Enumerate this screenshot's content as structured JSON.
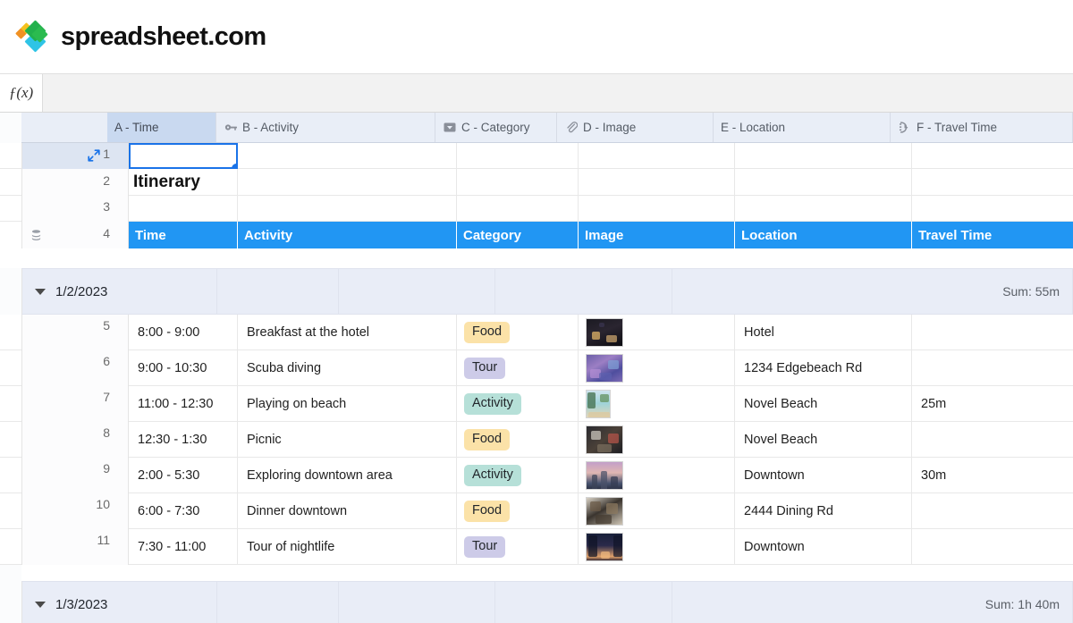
{
  "brand": {
    "name": "spreadsheet.com",
    "logo_icon": "diamond-logo-icon"
  },
  "formula_bar": {
    "fx_label": "ƒ(x)",
    "value": "",
    "placeholder": ""
  },
  "columns": [
    {
      "id": "A",
      "label": "A - Time",
      "icon": "none"
    },
    {
      "id": "B",
      "label": "B - Activity",
      "icon": "key-icon"
    },
    {
      "id": "C",
      "label": "C - Category",
      "icon": "dropdown-select-icon"
    },
    {
      "id": "D",
      "label": "D - Image",
      "icon": "paperclip-icon"
    },
    {
      "id": "E",
      "label": "E - Location",
      "icon": "none"
    },
    {
      "id": "F",
      "label": "F - Travel Time",
      "icon": "duration-clock-icon"
    }
  ],
  "top_rows": {
    "row1": {
      "number": "1",
      "a": "",
      "b": "",
      "c": "",
      "d": "",
      "e": "",
      "f": "",
      "selected": true,
      "expand_icon": "expand-arrows-icon"
    },
    "row2": {
      "number": "2",
      "title": "Itinerary"
    },
    "row3": {
      "number": "3"
    },
    "row4": {
      "number": "4",
      "db_icon": "database-stack-icon",
      "headers": [
        "Time",
        "Activity",
        "Category",
        "Image",
        "Location",
        "Travel Time"
      ]
    }
  },
  "groups": [
    {
      "label": "1/2/2023",
      "collapse_icon": "caret-down-icon",
      "sum": "Sum: 55m",
      "rows": [
        {
          "number": "5",
          "time": "8:00 - 9:00",
          "activity": "Breakfast at the hotel",
          "category": "Food",
          "image": "restaurant-night-thumbnail",
          "location": "Hotel",
          "travel": ""
        },
        {
          "number": "6",
          "time": "9:00 - 10:30",
          "activity": "Scuba diving",
          "category": "Tour",
          "image": "coral-reef-thumbnail",
          "location": "1234 Edgebeach Rd",
          "travel": ""
        },
        {
          "number": "7",
          "time": "11:00 - 12:30",
          "activity": "Playing on beach",
          "category": "Activity",
          "image": "beach-palm-thumbnail",
          "location": "Novel Beach",
          "travel": "25m"
        },
        {
          "number": "8",
          "time": "12:30 - 1:30",
          "activity": "Picnic",
          "category": "Food",
          "image": "picnic-table-thumbnail",
          "location": "Novel Beach",
          "travel": ""
        },
        {
          "number": "9",
          "time": "2:00 - 5:30",
          "activity": "Exploring downtown area",
          "category": "Activity",
          "image": "city-skyline-thumbnail",
          "location": "Downtown",
          "travel": "30m"
        },
        {
          "number": "10",
          "time": "6:00 - 7:30",
          "activity": "Dinner downtown",
          "category": "Food",
          "image": "food-spread-thumbnail",
          "location": "2444 Dining Rd",
          "travel": ""
        },
        {
          "number": "11",
          "time": "7:30 - 11:00",
          "activity": "Tour of nightlife",
          "category": "Tour",
          "image": "night-street-thumbnail",
          "location": "Downtown",
          "travel": ""
        }
      ]
    },
    {
      "label": "1/3/2023",
      "collapse_icon": "caret-down-icon",
      "sum": "Sum: 1h 40m",
      "rows": []
    }
  ],
  "category_colors": {
    "Food": "#fbe2a8",
    "Tour": "#cdcbe8",
    "Activity": "#b6e0d8"
  },
  "accent": {
    "table_header_blue": "#2196f3",
    "selection_blue": "#1a73e8",
    "header_bg": "#e9eef7"
  }
}
